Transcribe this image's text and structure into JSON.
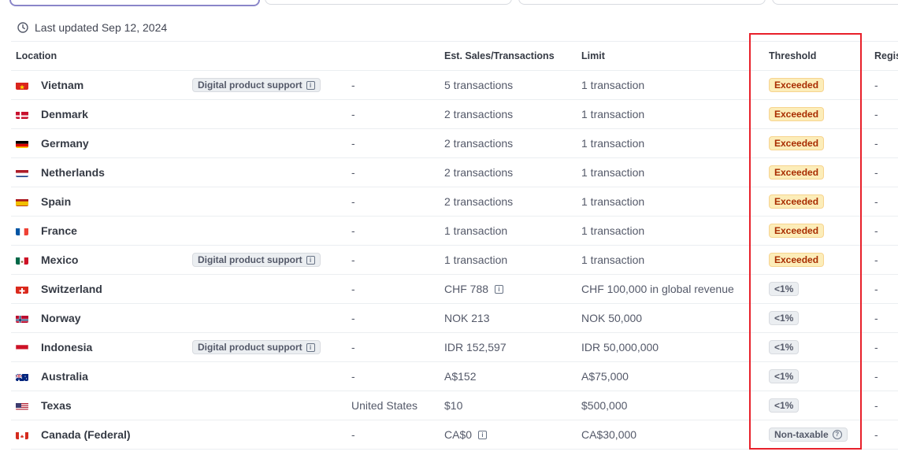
{
  "last_updated": "Last updated Sep 12, 2024",
  "columns": {
    "location": "Location",
    "est": "Est. Sales/Transactions",
    "limit": "Limit",
    "threshold": "Threshold",
    "registration": "Regis"
  },
  "rows": [
    {
      "location": "Vietnam",
      "tag": "Digital product support",
      "region": "-",
      "est": "5 transactions",
      "limit": "1 transaction",
      "threshold": "Exceeded",
      "reg": "-"
    },
    {
      "location": "Denmark",
      "tag": "",
      "region": "-",
      "est": "2 transactions",
      "limit": "1 transaction",
      "threshold": "Exceeded",
      "reg": "-"
    },
    {
      "location": "Germany",
      "tag": "",
      "region": "-",
      "est": "2 transactions",
      "limit": "1 transaction",
      "threshold": "Exceeded",
      "reg": "-"
    },
    {
      "location": "Netherlands",
      "tag": "",
      "region": "-",
      "est": "2 transactions",
      "limit": "1 transaction",
      "threshold": "Exceeded",
      "reg": "-"
    },
    {
      "location": "Spain",
      "tag": "",
      "region": "-",
      "est": "2 transactions",
      "limit": "1 transaction",
      "threshold": "Exceeded",
      "reg": "-"
    },
    {
      "location": "France",
      "tag": "",
      "region": "-",
      "est": "1 transaction",
      "limit": "1 transaction",
      "threshold": "Exceeded",
      "reg": "-"
    },
    {
      "location": "Mexico",
      "tag": "Digital product support",
      "region": "-",
      "est": "1 transaction",
      "limit": "1 transaction",
      "threshold": "Exceeded",
      "reg": "-"
    },
    {
      "location": "Switzerland",
      "tag": "",
      "region": "-",
      "est": "CHF 788",
      "limit": "CHF 100,000 in global revenue",
      "threshold": "<1%",
      "reg": "-"
    },
    {
      "location": "Norway",
      "tag": "",
      "region": "-",
      "est": "NOK 213",
      "limit": "NOK 50,000",
      "threshold": "<1%",
      "reg": "-"
    },
    {
      "location": "Indonesia",
      "tag": "Digital product support",
      "region": "-",
      "est": "IDR 152,597",
      "limit": "IDR 50,000,000",
      "threshold": "<1%",
      "reg": "-"
    },
    {
      "location": "Australia",
      "tag": "",
      "region": "-",
      "est": "A$152",
      "limit": "A$75,000",
      "threshold": "<1%",
      "reg": "-"
    },
    {
      "location": "Texas",
      "tag": "",
      "region": "United States",
      "est": "$10",
      "limit": "$500,000",
      "threshold": "<1%",
      "reg": "-"
    },
    {
      "location": "Canada (Federal)",
      "tag": "",
      "region": "-",
      "est": "CA$0",
      "limit": "CA$30,000",
      "threshold": "Non-taxable",
      "reg": "-"
    }
  ],
  "colors": {
    "exceeded_bg": "#fcedb9",
    "exceeded_text": "#a82c00",
    "neutral_bg": "#ebeef1",
    "highlight": "#e8202a"
  }
}
